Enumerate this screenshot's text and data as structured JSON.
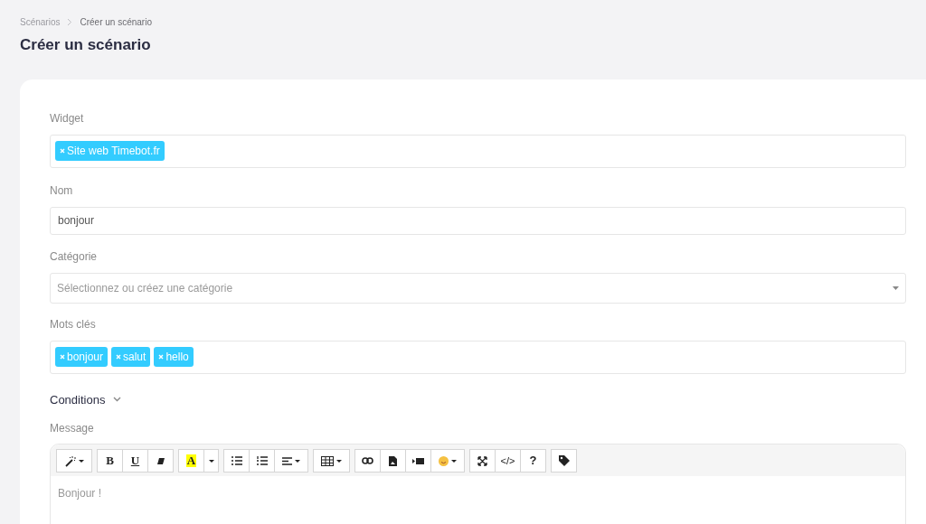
{
  "breadcrumb": [
    {
      "label": "Scénarios",
      "current": false
    },
    {
      "label": "Créer un scénario",
      "current": true
    }
  ],
  "title": "Créer un scénario",
  "widget": {
    "label": "Widget",
    "tags": [
      "Site web Timebot.fr"
    ]
  },
  "name": {
    "label": "Nom",
    "value": "bonjour"
  },
  "category": {
    "label": "Catégorie",
    "placeholder": "Sélectionnez ou créez une catégorie"
  },
  "keywords": {
    "label": "Mots clés",
    "tags": [
      "bonjour",
      "salut",
      "hello"
    ]
  },
  "conditions": {
    "label": "Conditions",
    "expanded": false
  },
  "message": {
    "label": "Message",
    "value": "Bonjour !",
    "toolbar": [
      [
        {
          "kind": "magic",
          "dropdown": true
        }
      ],
      [
        {
          "kind": "bold",
          "label": "B",
          "dropdown": false
        },
        {
          "kind": "underline",
          "label": "U",
          "dropdown": false
        },
        {
          "kind": "eraser",
          "dropdown": false
        }
      ],
      [
        {
          "kind": "highlight",
          "label": "A",
          "dropdown": false
        },
        {
          "kind": "caret",
          "dropdown": true
        }
      ],
      [
        {
          "kind": "ul",
          "dropdown": false
        },
        {
          "kind": "ol",
          "dropdown": false
        },
        {
          "kind": "align",
          "dropdown": true
        }
      ],
      [
        {
          "kind": "table",
          "dropdown": true
        }
      ],
      [
        {
          "kind": "link",
          "dropdown": false
        },
        {
          "kind": "picture",
          "dropdown": false
        },
        {
          "kind": "video",
          "dropdown": false
        },
        {
          "kind": "emoji",
          "dropdown": true
        }
      ],
      [
        {
          "kind": "fullscreen",
          "dropdown": false
        },
        {
          "kind": "code",
          "label": "</>",
          "dropdown": false
        },
        {
          "kind": "help",
          "label": "?",
          "dropdown": false
        }
      ],
      [
        {
          "kind": "tag",
          "dropdown": false
        }
      ]
    ]
  }
}
